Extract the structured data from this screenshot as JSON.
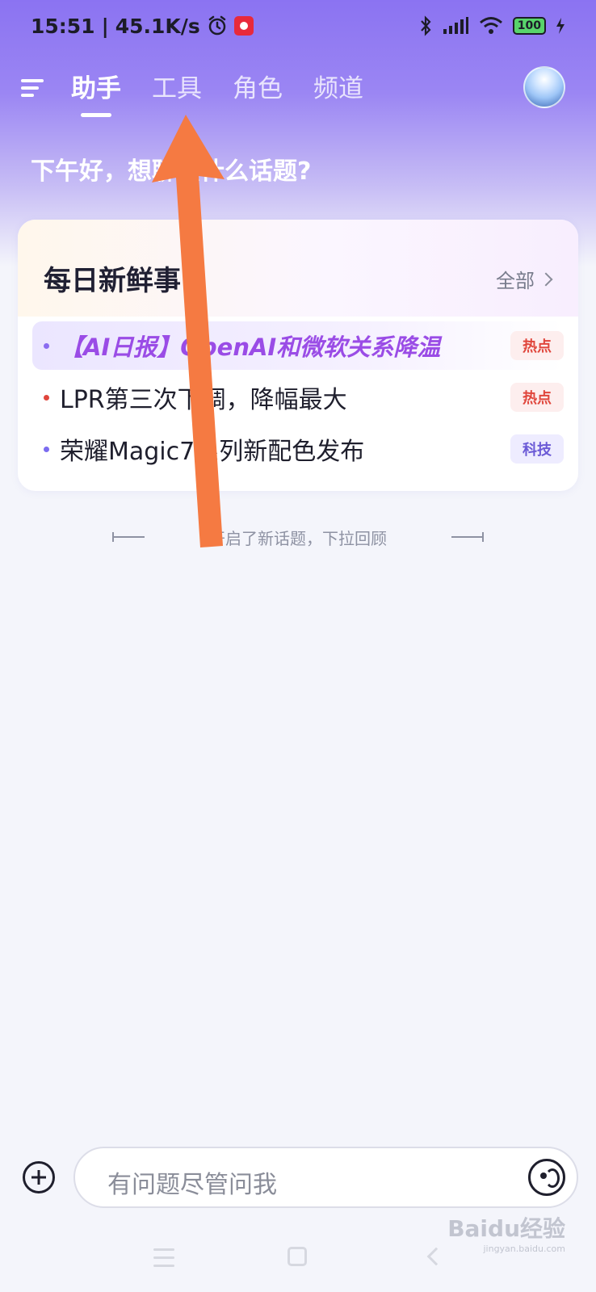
{
  "status_bar": {
    "time": "15:51",
    "speed": "45.1K/s",
    "battery": "100"
  },
  "nav": {
    "tabs": [
      {
        "label": "助手",
        "active": true
      },
      {
        "label": "工具",
        "active": false
      },
      {
        "label": "角色",
        "active": false
      },
      {
        "label": "频道",
        "active": false
      }
    ]
  },
  "greeting": "下午好，想聊点什么话题?",
  "card": {
    "title": "每日新鲜事",
    "more_label": "全部",
    "items": [
      {
        "text": "【AI日报】OpenAI和微软关系降温",
        "tag": "热点",
        "dot_color": "#8a6cf0",
        "tag_bg": "#fdeeee",
        "tag_color": "#e0463c"
      },
      {
        "text": "LPR第三次下调，降幅最大",
        "tag": "热点",
        "dot_color": "#e0463c",
        "tag_bg": "#fdeeee",
        "tag_color": "#e0463c"
      },
      {
        "text": "荣耀Magic7系列新配色发布",
        "tag": "科技",
        "dot_color": "#7b6cf0",
        "tag_bg": "#eeecff",
        "tag_color": "#6b5ad6"
      }
    ]
  },
  "divider_text": "开启了新话题，下拉回顾",
  "input": {
    "placeholder": "有问题尽管问我"
  },
  "watermark": {
    "brand": "Baidu经验",
    "url": "jingyan.baidu.com"
  },
  "colors": {
    "accent": "#8b73f2",
    "annotation_arrow": "#f57a42"
  }
}
